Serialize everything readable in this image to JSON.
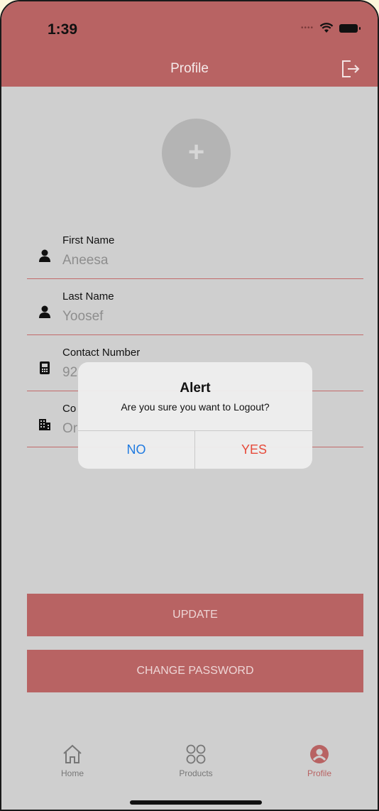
{
  "status_bar": {
    "time": "1:39"
  },
  "header": {
    "title": "Profile",
    "logout_icon": "logout-icon"
  },
  "avatar": {
    "symbol": "+"
  },
  "fields": [
    {
      "label": "First Name",
      "value": "Aneesa",
      "icon": "person-icon"
    },
    {
      "label": "Last Name",
      "value": "Yoosef",
      "icon": "person-icon"
    },
    {
      "label": "Contact Number",
      "value": "92",
      "icon": "phone-icon"
    },
    {
      "label": "Co",
      "value": "Or",
      "icon": "building-icon"
    }
  ],
  "alert": {
    "title": "Alert",
    "message": "Are you sure you want to Logout?",
    "no_label": "NO",
    "yes_label": "YES"
  },
  "buttons": {
    "update": "UPDATE",
    "change_password": "CHANGE PASSWORD"
  },
  "tabs": [
    {
      "label": "Home",
      "icon": "home-icon"
    },
    {
      "label": "Products",
      "icon": "grid-icon"
    },
    {
      "label": "Profile",
      "icon": "profile-icon"
    }
  ],
  "colors": {
    "accent": "#b86363",
    "background": "#cfcfcf",
    "alert_no": "#1f7ae0",
    "alert_yes": "#e64a3a"
  }
}
